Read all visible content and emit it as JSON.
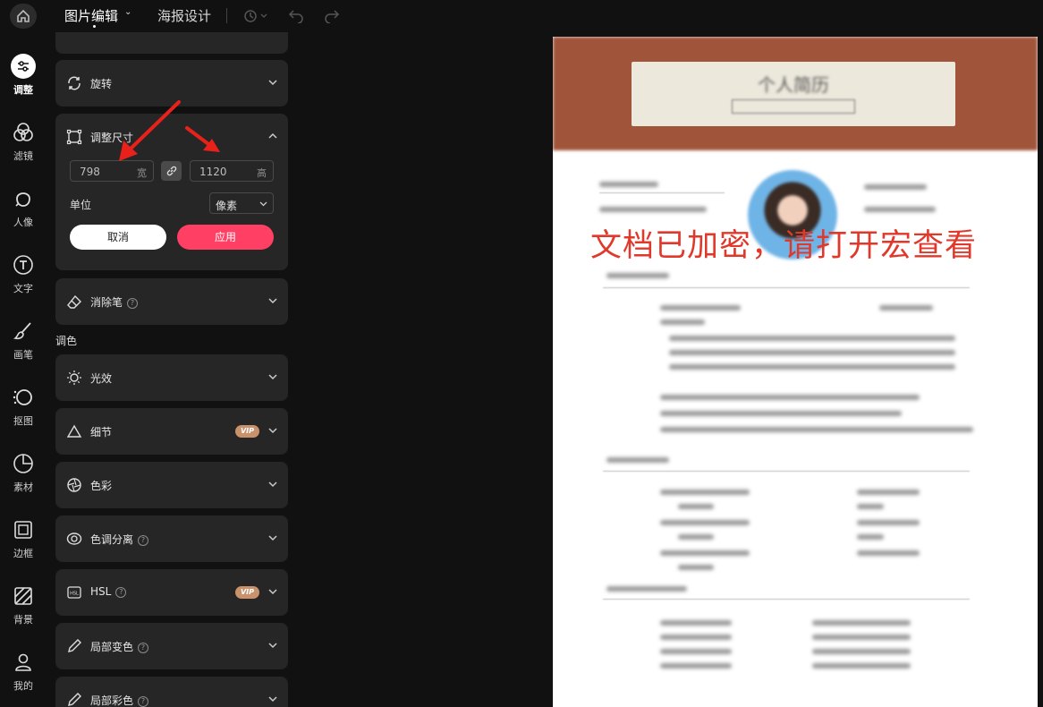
{
  "topbar": {
    "tab_image_edit": "图片编辑",
    "tab_poster": "海报设计"
  },
  "rail": [
    {
      "label": "调整",
      "icon": "adjust-icon",
      "active": true
    },
    {
      "label": "滤镜",
      "icon": "filter-icon"
    },
    {
      "label": "人像",
      "icon": "portrait-icon"
    },
    {
      "label": "文字",
      "icon": "text-icon"
    },
    {
      "label": "画笔",
      "icon": "brush-icon"
    },
    {
      "label": "抠图",
      "icon": "cutout-icon"
    },
    {
      "label": "素材",
      "icon": "material-icon"
    },
    {
      "label": "边框",
      "icon": "border-icon"
    },
    {
      "label": "背景",
      "icon": "background-icon"
    },
    {
      "label": "我的",
      "icon": "user-icon"
    }
  ],
  "panel": {
    "rotate_label": "旋转",
    "resize": {
      "title": "调整尺寸",
      "width_value": "798",
      "width_unit": "宽",
      "height_value": "1120",
      "height_unit": "高",
      "unit_label": "单位",
      "unit_value": "像素",
      "cancel": "取消",
      "apply": "应用"
    },
    "eraser_label": "消除笔",
    "color_section": "调色",
    "light_label": "光效",
    "detail_label": "细节",
    "vip_badge": "VIP",
    "color_label": "色彩",
    "tone_split_label": "色调分离",
    "hsl_label": "HSL",
    "local_change_label": "局部变色",
    "local_color_label": "局部彩色"
  },
  "canvas": {
    "doc_title": "个人简历",
    "watermark": "文档已加密，请打开宏查看"
  },
  "colors": {
    "accent": "#ff3f64",
    "background": "#111111",
    "card": "#262626",
    "vip": "#c9926b",
    "watermark": "#e0382b"
  }
}
